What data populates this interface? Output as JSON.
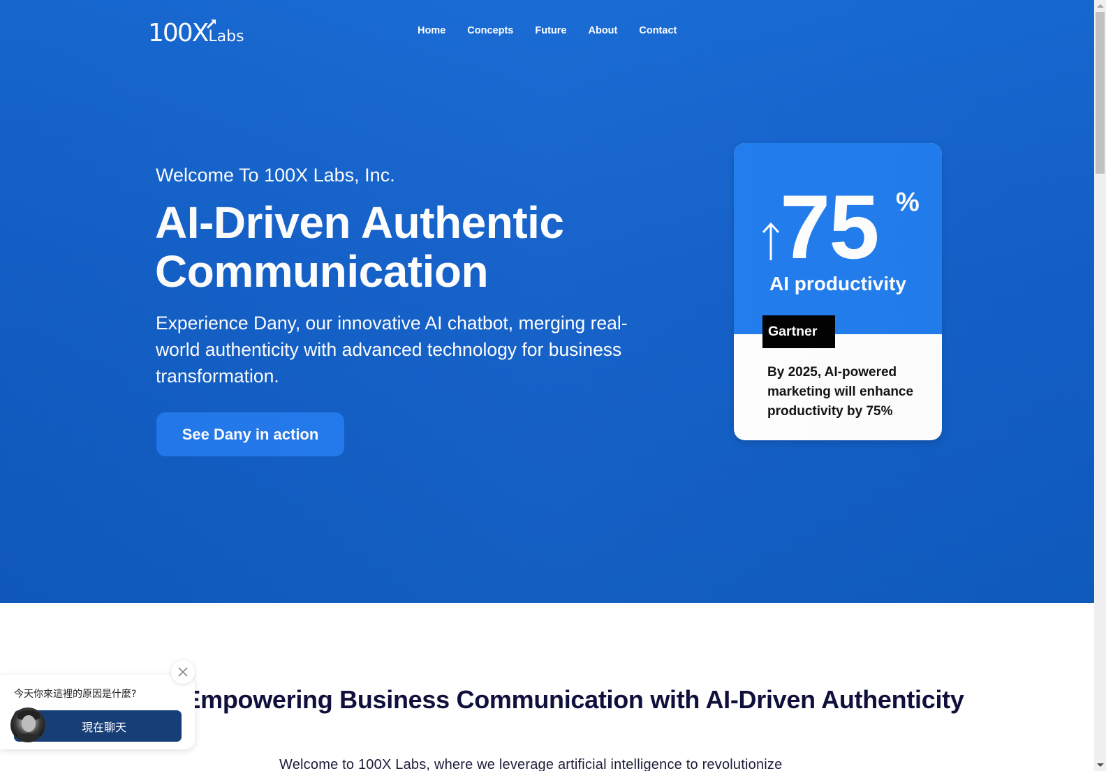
{
  "header": {
    "logo": {
      "main": "100X",
      "sub": "Labs"
    },
    "nav": [
      {
        "label": "Home"
      },
      {
        "label": "Concepts"
      },
      {
        "label": "Future"
      },
      {
        "label": "About"
      },
      {
        "label": "Contact"
      }
    ]
  },
  "hero": {
    "welcome": "Welcome To 100X Labs, Inc.",
    "headline": "AI-Driven Authentic Communication",
    "subtext": "Experience Dany, our innovative AI chatbot, merging real-world authenticity with advanced technology for business transformation.",
    "cta_label": "See Dany in action"
  },
  "stat_card": {
    "arrow_icon": "up-arrow-icon",
    "number": "75",
    "unit": "%",
    "label": "AI productivity",
    "source": "Gartner",
    "quote": "By 2025, AI-powered marketing will enhance productivity by 75%"
  },
  "section": {
    "title": "Empowering Business Communication with AI-Driven Authenticity",
    "intro": "Welcome to 100X Labs, where we leverage artificial intelligence to revolutionize"
  },
  "chat_widget": {
    "prompt": "今天你來這裡的原因是什麼?",
    "button_label": "現在聊天",
    "close_icon": "close-icon",
    "avatar_icon": "avatar"
  },
  "colors": {
    "hero_bg": "#1360c9",
    "card_accent": "#217ced",
    "cta_bg": "#2279ee",
    "chat_btn": "#183e78",
    "section_title": "#10103d"
  }
}
